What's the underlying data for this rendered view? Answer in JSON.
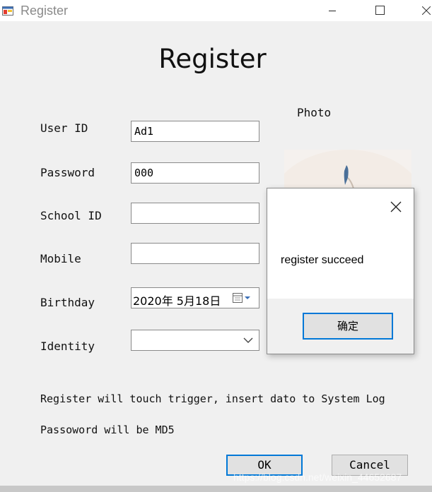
{
  "window": {
    "title": "Register",
    "icon": "app-form-icon"
  },
  "form": {
    "heading": "Register",
    "photo_label": "Photo",
    "fields": {
      "user_id": {
        "label": "User ID",
        "value": "Ad1"
      },
      "password": {
        "label": "Password",
        "value": "000"
      },
      "school_id": {
        "label": "School ID",
        "value": ""
      },
      "mobile": {
        "label": "Mobile",
        "value": ""
      },
      "birthday": {
        "label": "Birthday",
        "value": "2020年 5月18日"
      },
      "identity": {
        "label": "Identity",
        "value": ""
      }
    },
    "notes": [
      "Register will touch trigger, insert dato to System Log",
      "Passoword will be MD5"
    ],
    "ok_label": "OK",
    "cancel_label": "Cancel"
  },
  "message_box": {
    "text": "register succeed",
    "ok_label": "确定"
  },
  "watermark": "https://blog.csdn.net/weixin_44652687",
  "colors": {
    "accent": "#0078d7",
    "window_bg": "#f0f0f0"
  }
}
